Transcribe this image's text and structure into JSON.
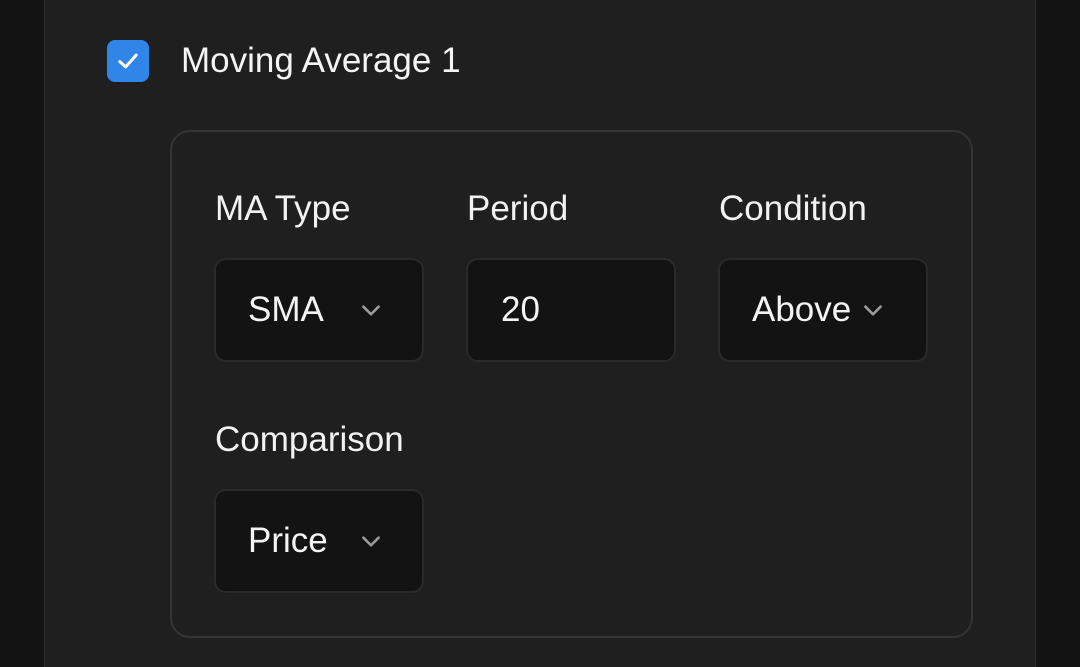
{
  "moving_average": {
    "title": "Moving Average 1",
    "enabled": true
  },
  "fields": {
    "ma_type": {
      "label": "MA Type",
      "value": "SMA"
    },
    "period": {
      "label": "Period",
      "value": "20"
    },
    "condition": {
      "label": "Condition",
      "value": "Above"
    },
    "comparison": {
      "label": "Comparison",
      "value": "Price"
    }
  },
  "colors": {
    "accent": "#2f86e8",
    "panel": "#1f1f1f",
    "control": "#131313"
  },
  "icons": {
    "checkbox": "check-icon",
    "dropdown": "chevron-down-icon"
  }
}
